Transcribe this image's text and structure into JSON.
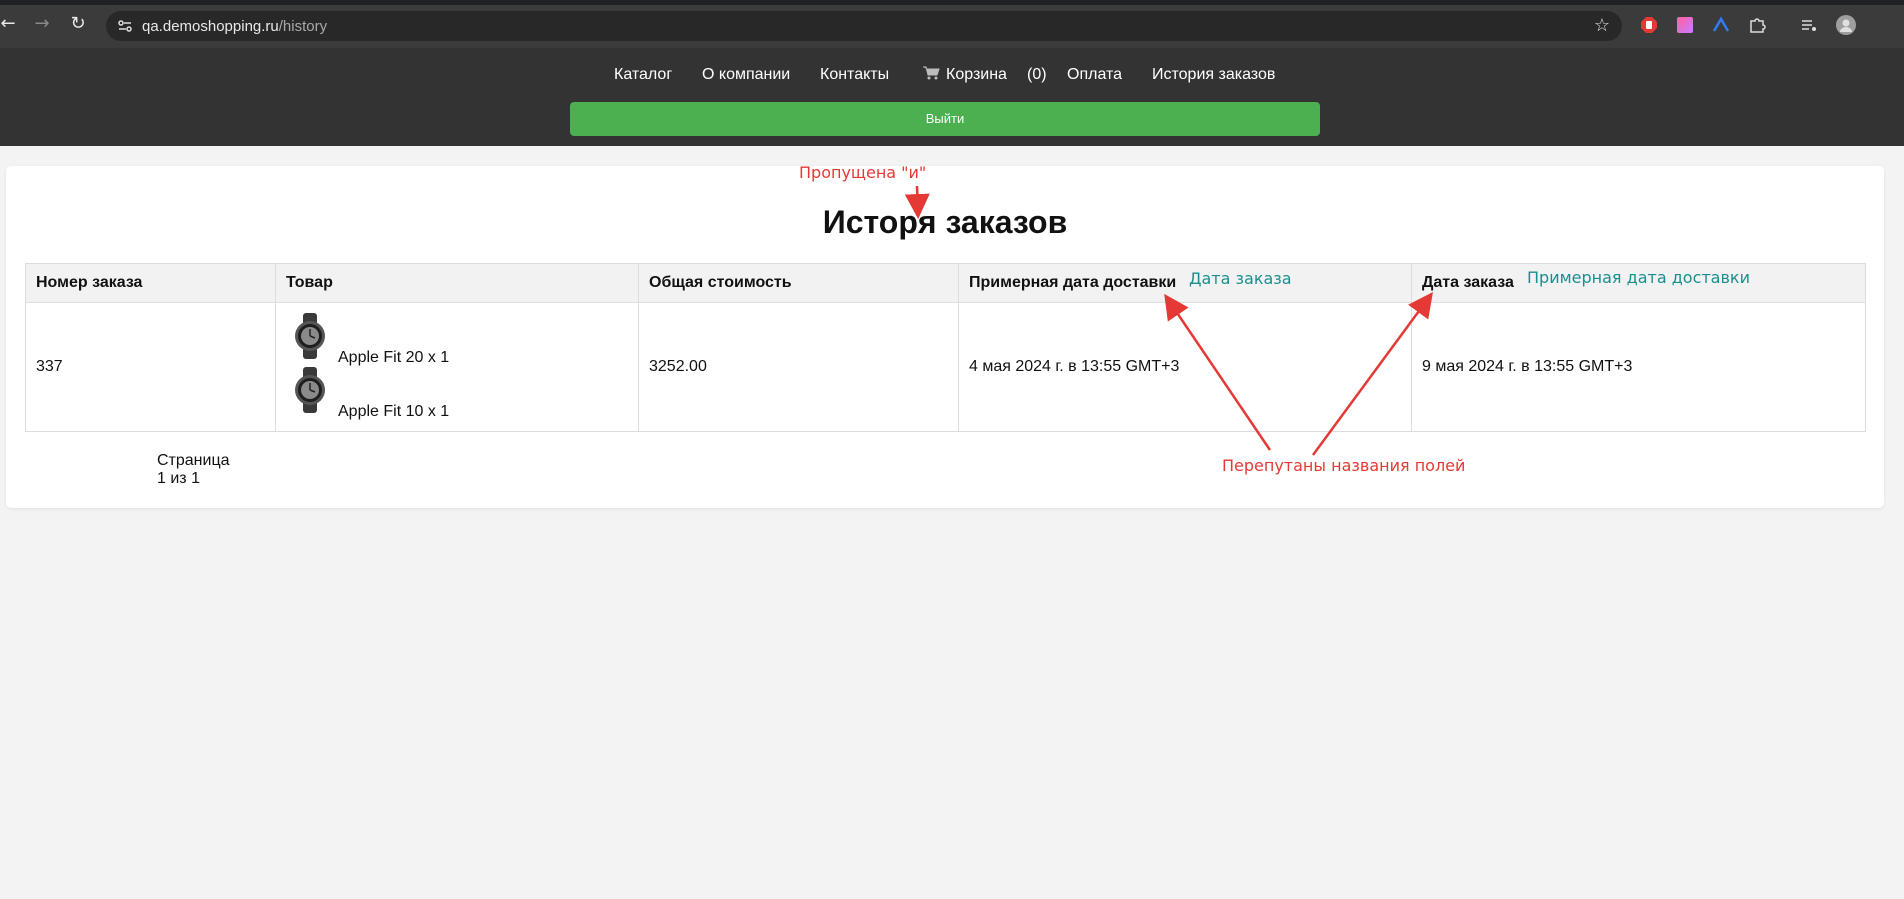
{
  "browser": {
    "url_host": "qa.demoshopping.ru",
    "url_path": "/history",
    "back_icon": "arrow-left-icon",
    "forward_icon": "arrow-right-icon",
    "reload_icon": "reload-icon",
    "bookmark_icon": "star-icon"
  },
  "nav": {
    "catalog": "Каталог",
    "about": "О компании",
    "contacts": "Контакты",
    "cart": "Корзина",
    "cart_count": "(0)",
    "payment": "Оплата",
    "history": "История заказов"
  },
  "logout_label": "Выйти",
  "page": {
    "title": "Истоpя заказов"
  },
  "table": {
    "headers": [
      "Номер заказа",
      "Товар",
      "Общая стоимость",
      "Примерная дата доставки",
      "Дата заказа"
    ],
    "rows": [
      {
        "order_number": "337",
        "products": [
          "Apple Fit 20 x 1",
          "Apple Fit 10 x 1"
        ],
        "total": "3252.00",
        "col4_date": "4 мая 2024 г. в 13:55 GMT+3",
        "col5_date": "9 мая 2024 г. в 13:55 GMT+3"
      }
    ]
  },
  "pagination": {
    "label": "Страница",
    "value": "1 из 1"
  },
  "annotations": {
    "missing_letter": "Пропущена \"и\"",
    "col4_correct": "Дата заказа",
    "col5_correct": "Примерная дата доставки",
    "swapped_fields": "Перепутаны названия полей"
  },
  "colors": {
    "header_bg": "#333333",
    "logout_bg": "#4caf50",
    "annotation_red": "#e53935",
    "annotation_teal": "#1a8f8f"
  }
}
